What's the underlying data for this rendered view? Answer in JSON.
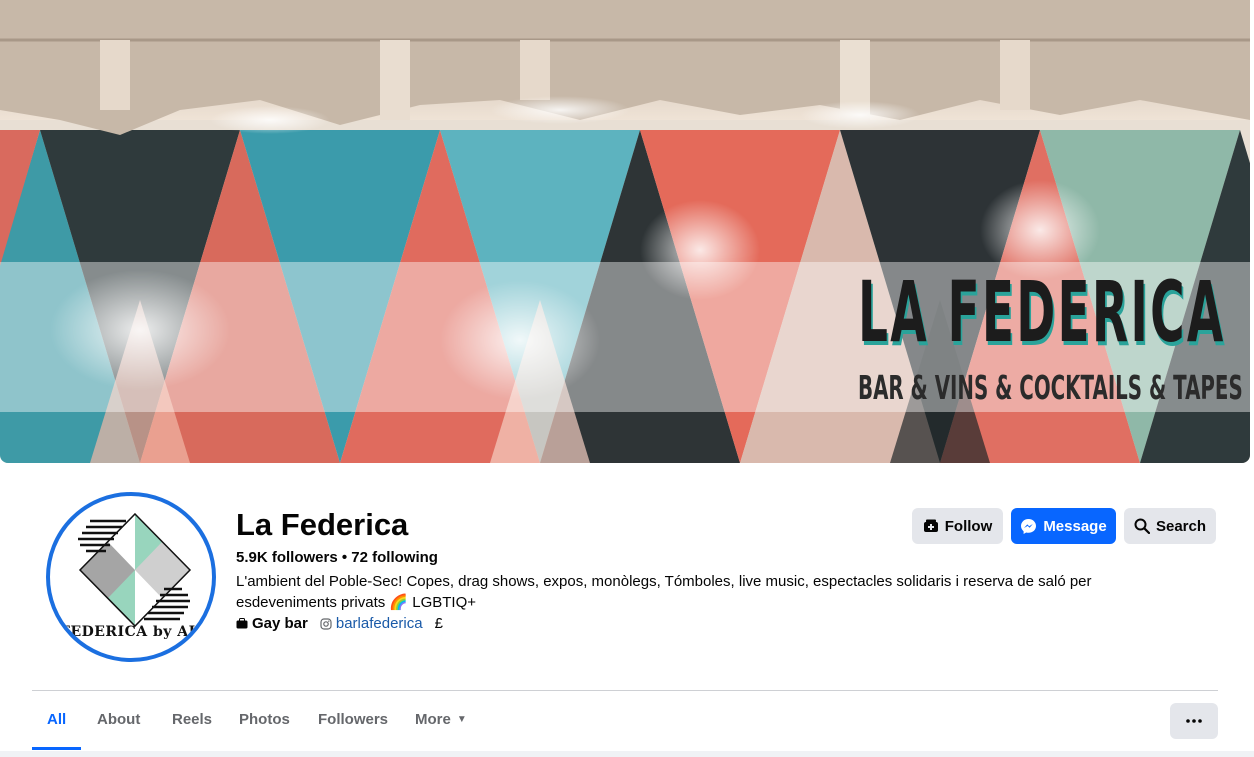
{
  "cover": {
    "title": "LA FEDERICA",
    "subtitle": "BAR & VINS & COCKTAILS & TAPES"
  },
  "avatar": {
    "text": "FEDERICA by ALBER"
  },
  "profile": {
    "name": "La Federica",
    "stats": "5.9K followers • 72 following",
    "bio": "L'ambient del Poble-Sec! Copes, drag shows, expos, monòlegs, Tómboles, live music, espectacles solidaris i reserva de saló per esdeveniments privats 🌈 LGBTIQ+",
    "category": "Gay bar",
    "instagram": "barlafederica",
    "price": "£"
  },
  "actions": {
    "follow": "Follow",
    "message": "Message",
    "search": "Search"
  },
  "tabs": {
    "all": "All",
    "about": "About",
    "reels": "Reels",
    "photos": "Photos",
    "followers": "Followers",
    "more": "More"
  },
  "colors": {
    "accent": "#0866ff",
    "button_gray": "#e4e6eb",
    "avatar_ring": "#1b6fe0",
    "link": "#1a5aa8"
  },
  "icons": {
    "follow": "follow-icon",
    "message": "messenger-icon",
    "search": "search-icon",
    "category": "category-icon",
    "instagram": "instagram-icon",
    "more": "chevron-down-icon",
    "options": "more-options-icon"
  }
}
